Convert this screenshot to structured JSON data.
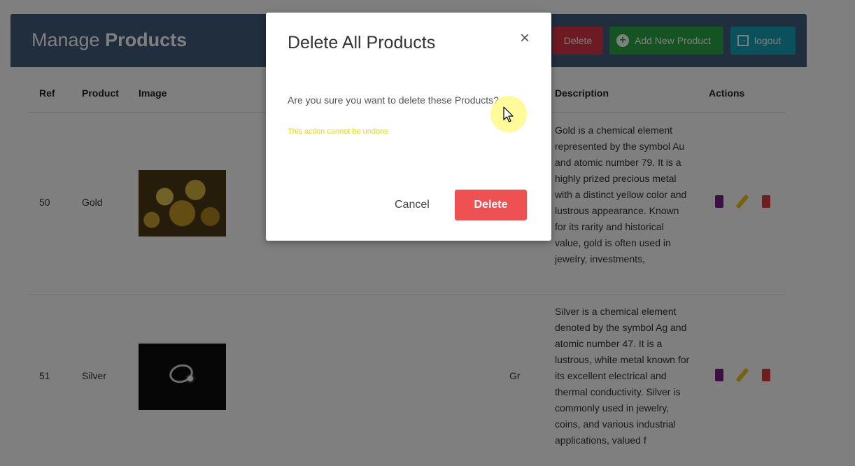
{
  "header": {
    "title_plain": "Manage",
    "title_bold": "Products",
    "delete_label": "Delete",
    "add_label": "Add New Product",
    "logout_label": "logout"
  },
  "table": {
    "headers": [
      "Ref",
      "Product",
      "Image",
      "Description",
      "Actions"
    ],
    "rows": [
      {
        "ref": "50",
        "product": "Gold",
        "category": "",
        "description": "Gold is a chemical element represented by the symbol Au and atomic number 79. It is a highly prized precious metal with a distinct yellow color and lustrous appearance. Known for its rarity and historical value, gold is often used in jewelry, investments,"
      },
      {
        "ref": "51",
        "product": "Silver",
        "category": "Gr",
        "description": "Silver is a chemical element denoted by the symbol Ag and atomic number 47. It is a lustrous, white metal known for its excellent electrical and thermal conductivity. Silver is commonly used in jewelry, coins, and various industrial applications, valued f"
      }
    ]
  },
  "modal": {
    "title": "Delete All Products",
    "close_symbol": "×",
    "message": "Are you sure you want to delete these Products?",
    "warning": "This action cannot be undone",
    "cancel_label": "Cancel",
    "delete_label": "Delete"
  },
  "colors": {
    "header_bg": "#435d7d",
    "delete": "#dc3545",
    "add": "#28a745",
    "logout": "#17a2b8",
    "modal_delete": "#ef5052",
    "warning_text": "#f0d80a"
  },
  "icons": {
    "add": "plus-circle-icon",
    "logout": "sign-out-icon",
    "close": "close-icon",
    "view": "book-icon",
    "edit": "pencil-icon",
    "delete": "trash-icon"
  }
}
